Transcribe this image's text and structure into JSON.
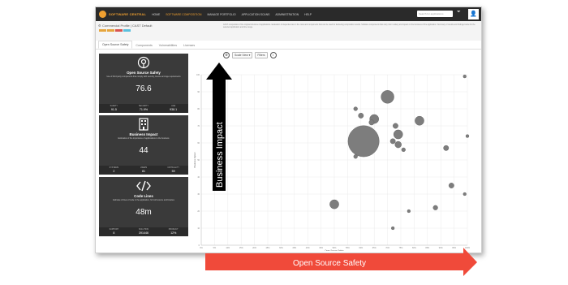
{
  "nav": {
    "logo": "SOFTWARE CENTRAL",
    "items": [
      "HOME",
      "SOFTWARE COMPOSITION",
      "MANAGE PORTFOLIO",
      "APPLICATION SCANS",
      "ADMINISTRATION",
      "HELP"
    ],
    "active_index": 1,
    "search_placeholder": "Search for applications",
    "user_icon": "user-icon",
    "filter_icon": "filter-icon"
  },
  "project": {
    "title": "Commercial Profile | CAST Default",
    "description": "CAST composition of the original structure of applications. Evaluation of dependencies in the code and components that can be used for delivering composition results. Software components that carry risk in safety and impact on the business of the application. Summary of results and findings below for the selected application and time range.",
    "tag_colors": [
      "#e6a53c",
      "#e6a53c",
      "#d9534f",
      "#5bc0de"
    ]
  },
  "tabs": [
    "Open Source Safety",
    "Components",
    "Vulnerabilities",
    "Licenses"
  ],
  "cards": [
    {
      "title": "Open Source Safety",
      "description": "Use of third party components that comply with security, license and age requirements",
      "value": "76.6",
      "stats": [
        {
          "label": "SAFETY",
          "value": "91.5"
        },
        {
          "label": "SECURITY",
          "value": "71.9%"
        },
        {
          "label": "AGE",
          "value": "938.1"
        }
      ],
      "icon": "open-source-icon"
    },
    {
      "title": "Business Impact",
      "description": "Estimation of the importance of applications to the business",
      "value": "44",
      "stats": [
        {
          "label": "SYSTEMS",
          "value": "2"
        },
        {
          "label": "USERS",
          "value": "81"
        },
        {
          "label": "CRITICALITY",
          "value": "59"
        }
      ],
      "icon": "building-icon"
    },
    {
      "title": "Code Lines",
      "description": "Estimate of lines of code in the application, for both source and binaries",
      "value": "48m",
      "stats": [
        {
          "label": "SUPPORT",
          "value": "8"
        },
        {
          "label": "SOLUTION",
          "value": "391446"
        },
        {
          "label": "PRODUCT",
          "value": "12%"
        }
      ],
      "icon": "code-icon"
    }
  ],
  "toolbar": {
    "settings_icon": "gear-icon",
    "scale_label": "Scale View ▾",
    "filter_label": "Filters",
    "info_icon": "info-icon"
  },
  "chart_data": {
    "type": "scatter",
    "xlabel": "Open Source Safety",
    "ylabel": "Business Impact",
    "x_ticks": [
      "0%",
      "5%",
      "10%",
      "15%",
      "20%",
      "25%",
      "30%",
      "35%",
      "40%",
      "45%",
      "50%",
      "55%",
      "60%",
      "65%",
      "70%",
      "75%",
      "80%",
      "85%",
      "90%",
      "95%",
      "100%"
    ],
    "y_ticks": [
      "0",
      "10",
      "20",
      "30",
      "40",
      "50",
      "60",
      "70",
      "80",
      "90",
      "100"
    ],
    "xlim": [
      0,
      100
    ],
    "ylim": [
      0,
      100
    ],
    "grid": true,
    "points": [
      {
        "x": 61,
        "y": 61,
        "r": 12
      },
      {
        "x": 70,
        "y": 87,
        "r": 5
      },
      {
        "x": 65,
        "y": 74,
        "r": 3.5
      },
      {
        "x": 64,
        "y": 72,
        "r": 2
      },
      {
        "x": 58,
        "y": 80,
        "r": 1.5
      },
      {
        "x": 60,
        "y": 76,
        "r": 2
      },
      {
        "x": 82,
        "y": 73,
        "r": 3.5
      },
      {
        "x": 73,
        "y": 70,
        "r": 2
      },
      {
        "x": 74,
        "y": 65,
        "r": 3.5
      },
      {
        "x": 74,
        "y": 59,
        "r": 2.5
      },
      {
        "x": 72,
        "y": 61,
        "r": 2
      },
      {
        "x": 76,
        "y": 56,
        "r": 1.5
      },
      {
        "x": 50,
        "y": 24,
        "r": 3.5
      },
      {
        "x": 58,
        "y": 52,
        "r": 1.5
      },
      {
        "x": 88,
        "y": 22,
        "r": 1.8
      },
      {
        "x": 94,
        "y": 35,
        "r": 2
      },
      {
        "x": 99,
        "y": 30,
        "r": 1.2
      },
      {
        "x": 78,
        "y": 20,
        "r": 1.2
      },
      {
        "x": 72,
        "y": 10,
        "r": 1.2
      },
      {
        "x": 99,
        "y": 99,
        "r": 1.2
      },
      {
        "x": 92,
        "y": 57,
        "r": 2
      },
      {
        "x": 100,
        "y": 64,
        "r": 1.2
      }
    ]
  },
  "annotations": {
    "y_arrow_label": "Business Impact",
    "x_arrow_label": "Open Source Safety",
    "x_arrow_color": "#f04a3a",
    "y_arrow_color": "#000000"
  }
}
